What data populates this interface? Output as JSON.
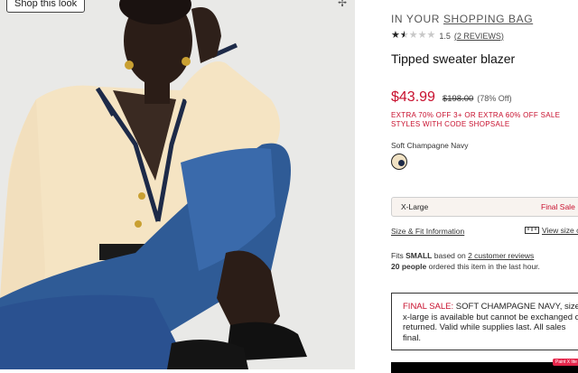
{
  "photo": {
    "shop_button": "Shop this look",
    "plus_icon": "plus-icon"
  },
  "bag": {
    "prefix": "IN YOUR",
    "link": "SHOPPING BAG"
  },
  "rating": {
    "stars_value": 1.5,
    "stars_max": 5,
    "value_text": "1.5",
    "reviews_link": "(2 REVIEWS)"
  },
  "product": {
    "title": "Tipped sweater blazer",
    "sale_price": "$43.99",
    "original_price": "$198.00",
    "discount": "(78% Off)",
    "promo": "EXTRA 70% OFF 3+ OR EXTRA 60% OFF SALE STYLES WITH CODE SHOPSALE"
  },
  "color": {
    "name": "Soft Champagne Navy",
    "swatch_colors": [
      "#f1e2c4",
      "#1d2a48"
    ]
  },
  "size": {
    "selected": "X-Large",
    "status": "Final Sale"
  },
  "links": {
    "size_fit": "Size & Fit Information",
    "view_size": "View size c"
  },
  "fit": {
    "fits_prefix": "Fits",
    "fits_size": "SMALL",
    "fits_middle": "based on",
    "fits_link": "2 customer reviews",
    "ordered_count": "20 people",
    "ordered_rest": "ordered this item in the last hour."
  },
  "final_sale": {
    "label": "FINAL SALE:",
    "text": "SOFT CHAMPAGNE NAVY, size x-large is available but cannot be exchanged or returned. Valid while supplies last. All sales final."
  },
  "badge": "Paint X lite",
  "colors": {
    "accent_red": "#c8102e",
    "size_box_bg": "#f8f3ef"
  }
}
